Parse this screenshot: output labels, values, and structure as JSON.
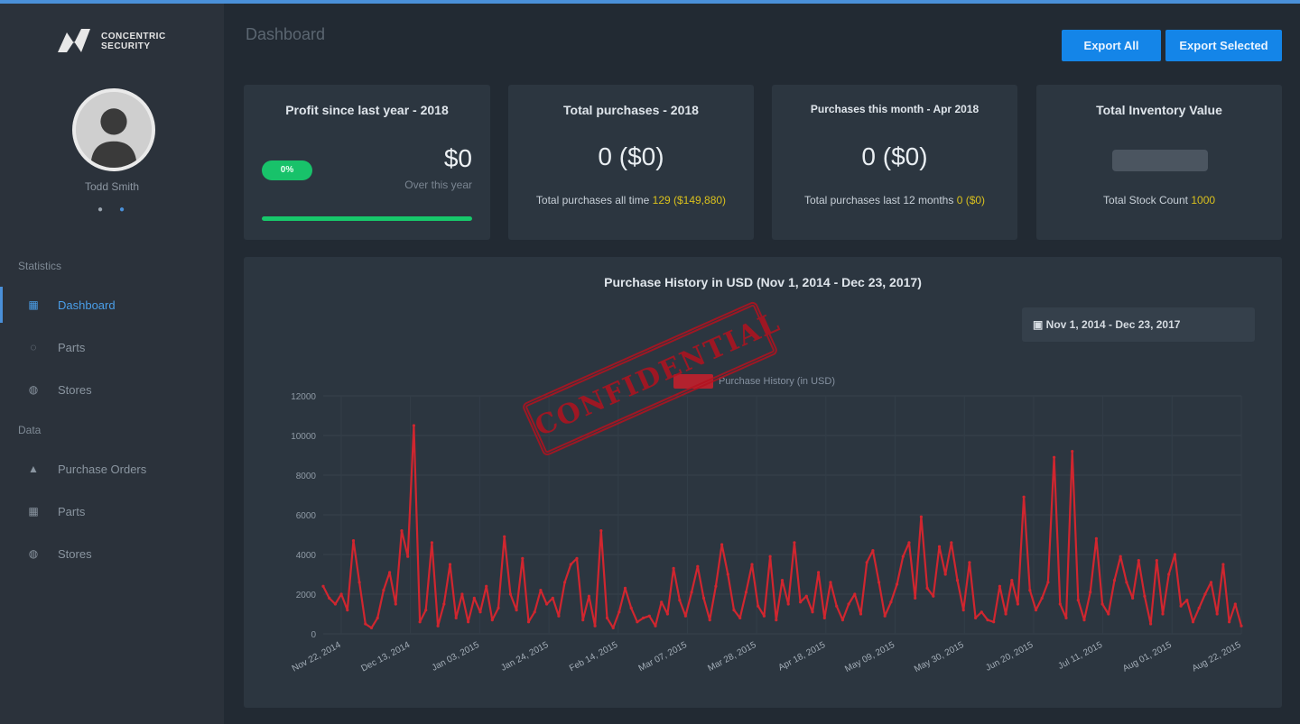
{
  "logo": {
    "icon": "logo-mark",
    "line1": "CONCENTRIC",
    "line2": "SECURITY"
  },
  "user": {
    "name": "Todd Smith",
    "icons": [
      "settings-icon",
      "info-icon"
    ]
  },
  "sidebar": {
    "sections": [
      {
        "title": "Statistics",
        "items": [
          {
            "label": "Dashboard",
            "icon": "dashboard-icon",
            "active": true
          },
          {
            "label": "Parts",
            "icon": "parts-icon"
          },
          {
            "label": "Stores",
            "icon": "stores-icon"
          }
        ]
      },
      {
        "title": "Data",
        "items": [
          {
            "label": "Purchase Orders",
            "icon": "orders-icon"
          },
          {
            "label": "Parts",
            "icon": "parts-icon"
          },
          {
            "label": "Stores",
            "icon": "stores-icon"
          }
        ]
      }
    ]
  },
  "header": {
    "title": "Dashboard",
    "export_all": "Export All",
    "export_selected": "Export Selected"
  },
  "cards": {
    "profit": {
      "title": "Profit since last year - 2018",
      "badge": "0%",
      "value": "$0",
      "sub": "Over this year",
      "progress": 1.0
    },
    "total_purchases": {
      "title": "Total purchases - 2018",
      "value": "0 ($0)",
      "sub_label": "Total purchases all time",
      "sub_value": "129 ($149,880)"
    },
    "month_purchases": {
      "title": "Purchases this month - Apr 2018",
      "value": "0 ($0)",
      "sub_label": "Total purchases last 12 months",
      "sub_value": "0 ($0)"
    },
    "inventory": {
      "title": "Total Inventory Value",
      "sub_label": "Total Stock Count",
      "sub_value": "1000"
    }
  },
  "chart_panel": {
    "title": "Purchase History in USD (Nov 1, 2014 - Dec 23, 2017)",
    "date_range": "Nov 1, 2014 - Dec 23, 2017",
    "stamp": "CONFIDENTIAL"
  },
  "chart_data": {
    "type": "line",
    "ylim": [
      0,
      12000
    ],
    "yticks": [
      "0",
      "2000",
      "4000",
      "6000",
      "8000",
      "10000",
      "12000"
    ],
    "xticks": [
      "Nov 22, 2014",
      "Dec 13, 2014",
      "Jan 03, 2015",
      "Jan 24, 2015",
      "Feb 14, 2015",
      "Mar 07, 2015",
      "Mar 28, 2015",
      "Apr 18, 2015",
      "May 09, 2015",
      "May 30, 2015",
      "Jun 20, 2015",
      "Jul 11, 2015",
      "Aug 01, 2015",
      "Aug 22, 2015"
    ],
    "legend": "Purchase History (in USD)",
    "color": "#d0262f",
    "series": [
      {
        "values": [
          2400,
          1800,
          1500,
          2000,
          1200,
          4700,
          2600,
          500,
          300,
          800,
          2200,
          3100,
          1500,
          5200,
          3900,
          10500,
          600,
          1200,
          4600,
          400,
          1500,
          3500,
          800,
          2000,
          600,
          1800,
          1100,
          2400,
          700,
          1300,
          4900,
          2000,
          1200,
          3800,
          600,
          1100,
          2200,
          1500,
          1800,
          900,
          2600,
          3500,
          3800,
          700,
          1900,
          400,
          5200,
          800,
          300,
          1100,
          2300,
          1300,
          600,
          800,
          900,
          400,
          1600,
          1000,
          3300,
          1700,
          900,
          2100,
          3400,
          1800,
          700,
          2400,
          4500,
          3000,
          1200,
          800,
          2100,
          3500,
          1400,
          900,
          3900,
          700,
          2700,
          1500,
          4600,
          1600,
          1900,
          1100,
          3100,
          800,
          2600,
          1400,
          700,
          1500,
          2000,
          1000,
          3600,
          4200,
          2600,
          900,
          1600,
          2500,
          3900,
          4600,
          1800,
          5900,
          2300,
          1900,
          4400,
          3000,
          4600,
          2700,
          1200,
          3600,
          800,
          1100,
          700,
          600,
          2400,
          1000,
          2700,
          1500,
          6900,
          2200,
          1200,
          1800,
          2600,
          8900,
          1500,
          800,
          9200,
          1700,
          700,
          2100,
          4800,
          1500,
          1000,
          2700,
          3900,
          2600,
          1800,
          3700,
          1900,
          500,
          3700,
          1000,
          3000,
          4000,
          1400,
          1700,
          600,
          1300,
          2000,
          2600,
          1000,
          3500,
          600,
          1500,
          400
        ]
      }
    ]
  }
}
